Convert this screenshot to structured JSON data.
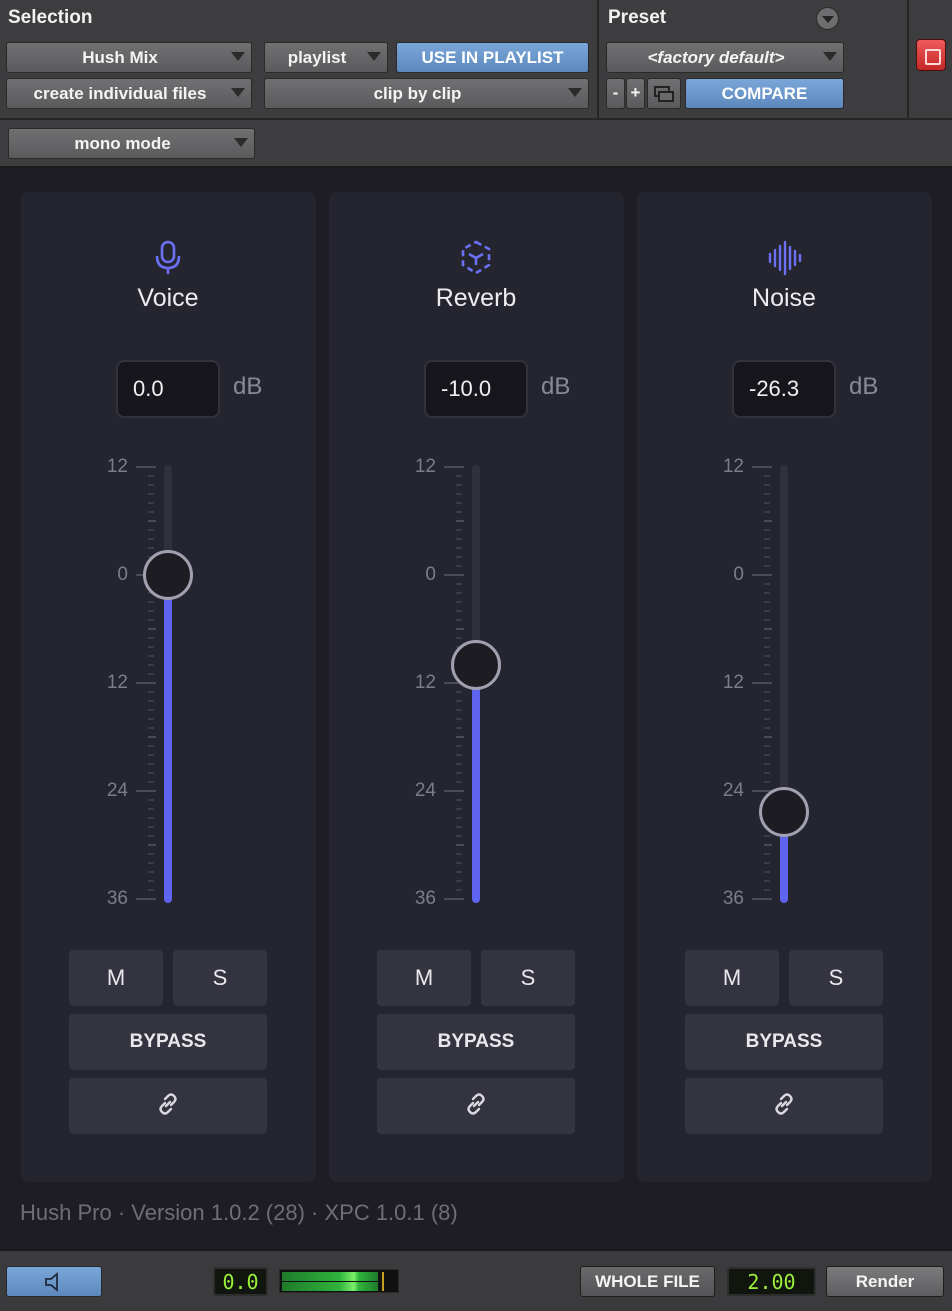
{
  "header": {
    "selection_title": "Selection",
    "preset_title": "Preset",
    "source_select": "Hush Mix",
    "playlist_select": "playlist",
    "use_in_playlist": "USE IN PLAYLIST",
    "files_select": "create individual files",
    "clip_select": "clip by clip",
    "mono_select": "mono mode",
    "preset_select": "<factory default>",
    "minus": "-",
    "plus": "+",
    "compare": "COMPARE"
  },
  "channels": [
    {
      "title": "Voice",
      "value": "0.0",
      "unit": "dB",
      "icon": "microphone-icon",
      "level_db": 0.0,
      "mute": "M",
      "solo": "S",
      "bypass": "BYPASS"
    },
    {
      "title": "Reverb",
      "value": "-10.0",
      "unit": "dB",
      "icon": "reverb-cube-icon",
      "level_db": -10.0,
      "mute": "M",
      "solo": "S",
      "bypass": "BYPASS"
    },
    {
      "title": "Noise",
      "value": "-26.3",
      "unit": "dB",
      "icon": "waveform-icon",
      "level_db": -26.3,
      "mute": "M",
      "solo": "S",
      "bypass": "BYPASS"
    }
  ],
  "scale_labels": [
    "12",
    "0",
    "12",
    "24",
    "36"
  ],
  "footer": {
    "version": "Hush Pro · Version 1.0.2 (28) · XPC 1.0.1 (8)"
  },
  "bottom": {
    "level_readout": "0.0",
    "whole_file": "WHOLE FILE",
    "speed_readout": "2.00",
    "render": "Render"
  },
  "colors": {
    "accent": "#5f64f0",
    "pt_blue": "#6b96cb",
    "lcd_green": "#9bee3a",
    "power_red": "#d83a3a"
  }
}
